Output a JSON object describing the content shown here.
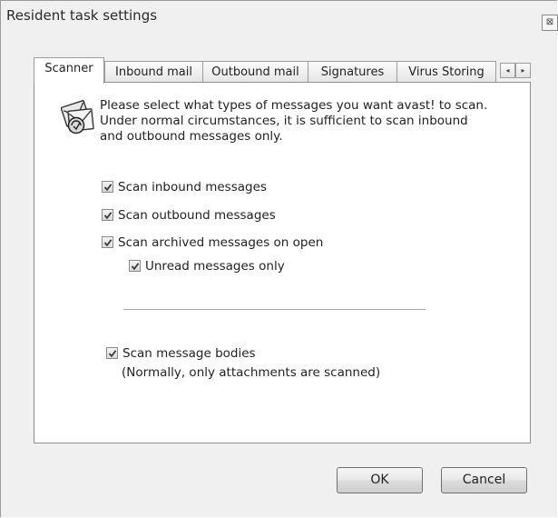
{
  "window": {
    "title": "Resident task settings",
    "close_glyph": "⊠"
  },
  "tabs": [
    {
      "label": "Scanner",
      "active": true
    },
    {
      "label": "Inbound mail",
      "active": false
    },
    {
      "label": "Outbound mail",
      "active": false
    },
    {
      "label": "Signatures",
      "active": false
    },
    {
      "label": "Virus Storing",
      "active": false
    }
  ],
  "tab_scroll": {
    "left": "◂",
    "right": "▸"
  },
  "scanner": {
    "icon": "mail-shield-icon",
    "description_lines": [
      "Please select what types of messages you want avast! to scan.",
      "Under normal circumstances, it is sufficient to scan inbound",
      "and outbound messages only."
    ],
    "options": {
      "scan_inbound": {
        "label": "Scan inbound messages",
        "checked": true
      },
      "scan_outbound": {
        "label": "Scan outbound messages",
        "checked": true
      },
      "scan_archived": {
        "label": "Scan archived messages on open",
        "checked": true
      },
      "unread_only": {
        "label": "Unread messages only",
        "checked": true
      },
      "scan_bodies": {
        "label": "Scan message bodies",
        "checked": true
      }
    },
    "bodies_note": "(Normally, only attachments are scanned)"
  },
  "buttons": {
    "ok": "OK",
    "cancel": "Cancel"
  }
}
